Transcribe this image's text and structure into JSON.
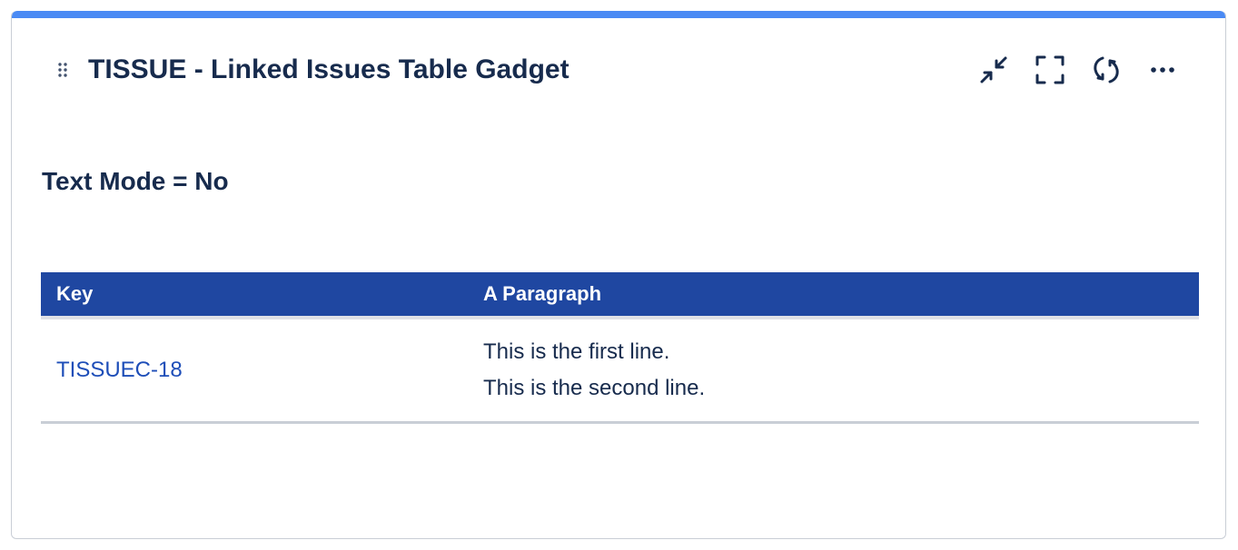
{
  "gadget": {
    "title": "TISSUE - Linked Issues Table Gadget",
    "accent_color": "#4a8af4",
    "actions": [
      {
        "name": "minimize",
        "icon": "minimize-arrows-icon"
      },
      {
        "name": "maximize",
        "icon": "fullscreen-corners-icon"
      },
      {
        "name": "refresh",
        "icon": "refresh-icon"
      },
      {
        "name": "more",
        "icon": "more-dots-icon"
      }
    ]
  },
  "content": {
    "subtitle": "Text Mode = No"
  },
  "table": {
    "header_color": "#1f47a1",
    "link_color": "#1e4eb8",
    "columns": [
      "Key",
      "A Paragraph"
    ],
    "rows": [
      {
        "key": "TISSUEC-18",
        "paragraph_lines": [
          "This is the first line.",
          "This is the second line."
        ]
      }
    ]
  }
}
